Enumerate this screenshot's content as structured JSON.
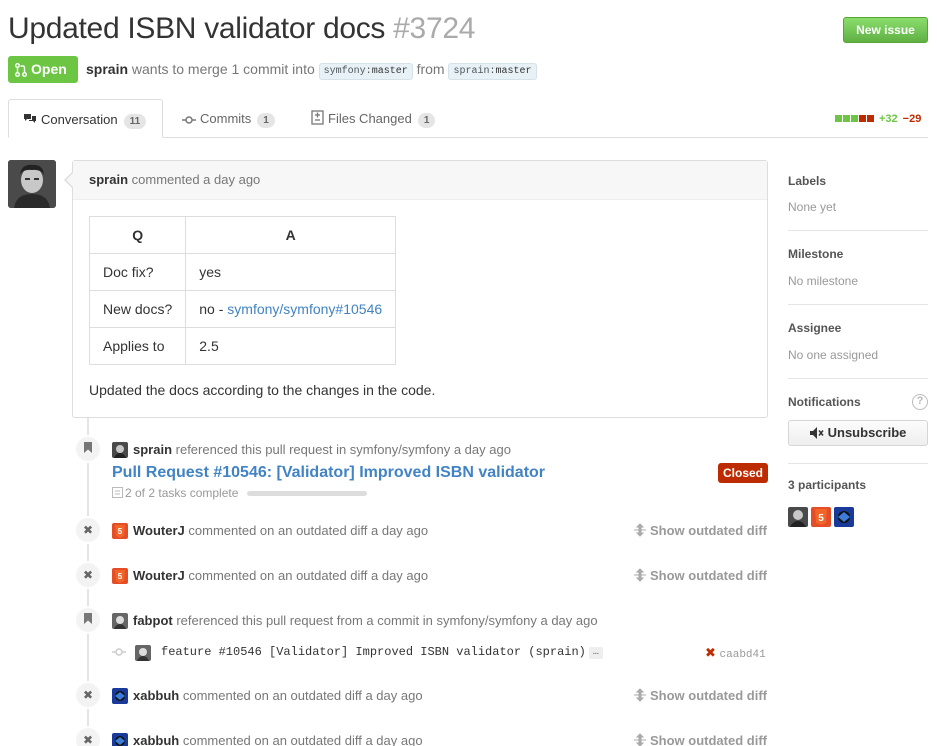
{
  "header": {
    "title": "Updated ISBN validator docs",
    "number": "#3724",
    "new_issue_label": "New issue",
    "state_label": "Open",
    "author": "sprain",
    "merge_text": "wants to merge 1 commit into",
    "base_branch_repo": "symfony",
    "base_branch_name": "master",
    "from_text": "from",
    "head_branch_repo": "sprain",
    "head_branch_name": "master"
  },
  "tabs": [
    {
      "label": "Conversation",
      "count": "11",
      "icon": "comment-discussion-icon"
    },
    {
      "label": "Commits",
      "count": "1",
      "icon": "git-commit-icon"
    },
    {
      "label": "Files Changed",
      "count": "1",
      "icon": "diff-icon"
    }
  ],
  "diffstat": {
    "additions": "+32",
    "deletions": "−29"
  },
  "comment": {
    "author": "sprain",
    "meta": "commented a day ago",
    "table_headers": [
      "Q",
      "A"
    ],
    "rows": [
      {
        "q": "Doc fix?",
        "a": "yes",
        "a_link": ""
      },
      {
        "q": "New docs?",
        "a": "no - ",
        "a_link": "symfony/symfony#10546"
      },
      {
        "q": "Applies to",
        "a": "2.5",
        "a_link": ""
      }
    ],
    "body": "Updated the docs according to the changes in the code."
  },
  "timeline": {
    "ref1": {
      "author": "sprain",
      "text": "referenced this pull request in symfony/symfony a day ago"
    },
    "pr": {
      "title": "Pull Request #10546: [Validator] Improved ISBN validator",
      "state": "Closed",
      "tasks": "2 of 2 tasks complete"
    },
    "ev1": {
      "author": "WouterJ",
      "text": "commented on an outdated diff a day ago",
      "action": "Show outdated diff"
    },
    "ev2": {
      "author": "WouterJ",
      "text": "commented on an outdated diff a day ago",
      "action": "Show outdated diff"
    },
    "ref2": {
      "author": "fabpot",
      "text": "referenced this pull request from a commit in symfony/symfony a day ago"
    },
    "commit": {
      "message": "feature #10546 [Validator] Improved ISBN validator (sprain)",
      "ellipsis": "…",
      "sha": "caabd41"
    },
    "ev3": {
      "author": "xabbuh",
      "text": "commented on an outdated diff a day ago",
      "action": "Show outdated diff"
    },
    "ev4": {
      "author": "xabbuh",
      "text": "commented on an outdated diff a day ago",
      "action": "Show outdated diff"
    }
  },
  "sidebar": {
    "labels_title": "Labels",
    "labels_value": "None yet",
    "milestone_title": "Milestone",
    "milestone_value": "No milestone",
    "assignee_title": "Assignee",
    "assignee_value": "No one assigned",
    "notifications_title": "Notifications",
    "help_glyph": "?",
    "unsubscribe_label": "Unsubscribe",
    "participants_title": "3 participants"
  },
  "colors": {
    "open_green": "#6cc644",
    "closed_red": "#bd2c00",
    "link_blue": "#4183c4"
  }
}
